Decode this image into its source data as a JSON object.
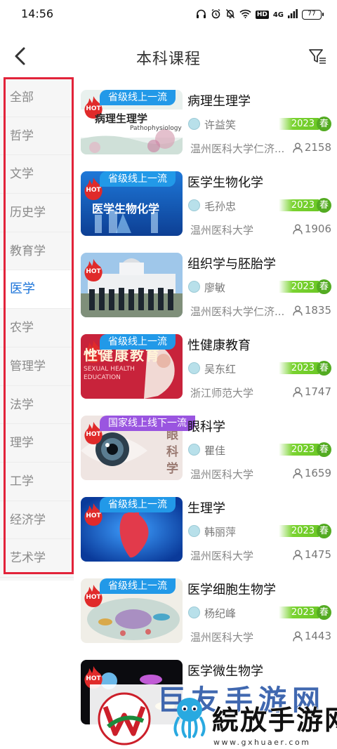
{
  "status_bar": {
    "time": "14:56",
    "network": "4G",
    "hd": "HD",
    "battery": "77"
  },
  "header": {
    "title": "本科课程"
  },
  "sidebar": {
    "items": [
      {
        "label": "全部"
      },
      {
        "label": "哲学"
      },
      {
        "label": "文学"
      },
      {
        "label": "历史学"
      },
      {
        "label": "教育学"
      },
      {
        "label": "医学"
      },
      {
        "label": "农学"
      },
      {
        "label": "管理学"
      },
      {
        "label": "法学"
      },
      {
        "label": "理学"
      },
      {
        "label": "工学"
      },
      {
        "label": "经济学"
      },
      {
        "label": "艺术学"
      }
    ],
    "active": "医学"
  },
  "hot_label": "HOT",
  "courses": [
    {
      "title": "病理生理学",
      "ribbon": "省级线上一流",
      "thumb_caption": "病理生理学",
      "thumb_sub": "Pathophysiology",
      "teacher": "许益笑",
      "year": "2023",
      "season": "春",
      "school": "温州医科大学仁济...",
      "views": "2158"
    },
    {
      "title": "医学生物化学",
      "ribbon": "省级线上一流",
      "thumb_caption": "医学生物化学",
      "teacher": "毛孙忠",
      "year": "2023",
      "season": "春",
      "school": "温州医科大学",
      "views": "1906"
    },
    {
      "title": "组织学与胚胎学",
      "teacher": "廖敏",
      "year": "2023",
      "season": "春",
      "school": "温州医科大学仁济...",
      "views": "1835"
    },
    {
      "title": "性健康教育",
      "ribbon": "省级线上一流",
      "thumb_caption": "性健康教育",
      "thumb_sub": "SEXUAL HEALTH EDUCATION",
      "teacher": "吴东红",
      "year": "2023",
      "season": "春",
      "school": "浙江师范大学",
      "views": "1747"
    },
    {
      "title": "眼科学",
      "ribbon": "国家线上线下一流",
      "thumb_caption": "眼科学",
      "teacher": "瞿佳",
      "year": "2023",
      "season": "春",
      "school": "温州医科大学",
      "views": "1659"
    },
    {
      "title": "生理学",
      "ribbon": "省级线上一流",
      "teacher": "韩丽萍",
      "year": "2023",
      "season": "春",
      "school": "温州医科大学",
      "views": "1475"
    },
    {
      "title": "医学细胞生物学",
      "ribbon": "省级线上一流",
      "teacher": "杨纪峰",
      "year": "2023",
      "season": "春",
      "school": "温州医科大学",
      "views": "1443"
    },
    {
      "title": "医学微生物学"
    }
  ],
  "watermark": {
    "line1": "巨友手游网",
    "name": "綄放手游网",
    "url": "www.gxhuaer.com"
  },
  "colors": {
    "accent": "#1a73d9",
    "highlight_border": "#e2233a",
    "term_green": "#6cc826",
    "ribbon_blue": "#2299e8",
    "ribbon_purple": "#9a55e0"
  }
}
